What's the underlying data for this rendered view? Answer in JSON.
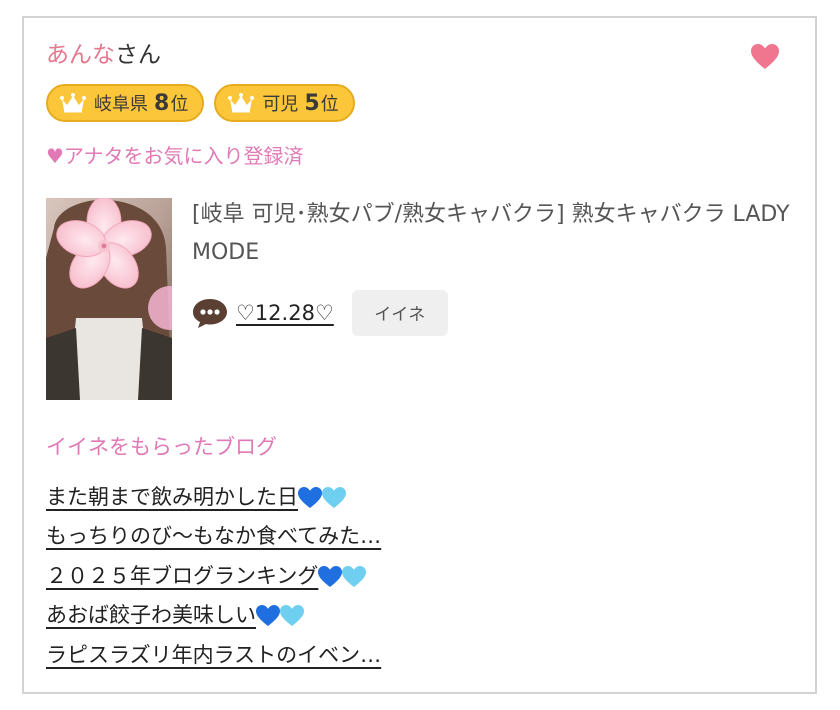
{
  "profile": {
    "name": "あんな",
    "name_suffix": "さん"
  },
  "badges": [
    {
      "area": "岐阜県",
      "rank": "8",
      "unit": "位"
    },
    {
      "area": "可児",
      "rank": "5",
      "unit": "位"
    }
  ],
  "favorite_status": "♥アナタをお気に入り登録済",
  "shop": {
    "title": "[岐阜 可児･熟女パブ/熟女キャバクラ]  熟女キャバクラ LADY MODE"
  },
  "post": {
    "date_label": "♡12.28♡",
    "like_label": "イイネ"
  },
  "blog_section": {
    "heading": "イイネをもらったブログ",
    "items": [
      {
        "text": "また朝まで飲み明かした日",
        "hearts": [
          "blue-heart",
          "light-blue-heart"
        ]
      },
      {
        "text": "もっちりのび〜もなか食べてみた…",
        "hearts": []
      },
      {
        "text": "２０２５年ブログランキング",
        "hearts": [
          "blue-heart",
          "light-blue-heart"
        ]
      },
      {
        "text": "あおば餃子わ美味しい",
        "hearts": [
          "blue-heart",
          "light-blue-heart"
        ]
      },
      {
        "text": "ラピスラズリ年内ラストのイベン…",
        "hearts": []
      }
    ]
  },
  "colors": {
    "pink": "#e4798f",
    "fav_pink": "#e079b6",
    "badge_gold": "#fcc63a",
    "heart_blue": "#1f6fe0",
    "heart_light_blue": "#6fcff0"
  },
  "icons": {
    "favorite": "heart-icon",
    "badge": "crown-icon",
    "comment": "speech-bubble-icon"
  }
}
